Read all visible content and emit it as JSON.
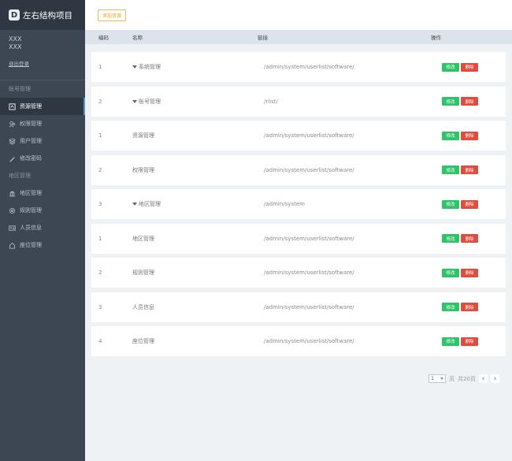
{
  "brand": {
    "logo_letter": "D",
    "title": "左右结构项目"
  },
  "user": {
    "name1": "XXX",
    "name2": "XXX",
    "logout": "退出登录"
  },
  "nav_groups": [
    {
      "title": "账号管理",
      "items": [
        {
          "label": "资源管理",
          "icon": "resource-icon",
          "active": true
        },
        {
          "label": "权限管理",
          "icon": "users-icon",
          "active": false
        },
        {
          "label": "用户管理",
          "icon": "layers-icon",
          "active": false
        },
        {
          "label": "修改密码",
          "icon": "pen-icon",
          "active": false
        }
      ]
    },
    {
      "title": "地区管理",
      "items": [
        {
          "label": "地区管理",
          "icon": "bank-icon",
          "active": false
        },
        {
          "label": "规则管理",
          "icon": "gear-icon",
          "active": false
        },
        {
          "label": "人员信息",
          "icon": "id-card-icon",
          "active": false
        },
        {
          "label": "座位管理",
          "icon": "home-icon",
          "active": false
        }
      ]
    }
  ],
  "toolbar": {
    "add_label": "添加资源"
  },
  "table": {
    "headers": {
      "id": "编码",
      "name": "名称",
      "link": "链接",
      "op": "操作"
    },
    "edit_label": "修改",
    "delete_label": "删除",
    "rows": [
      {
        "id": "1",
        "name": "系统管理",
        "link": "/admin/system/userlist/software/",
        "expand": true
      },
      {
        "id": "2",
        "name": "账号管理",
        "link": "/rlist/",
        "expand": true
      },
      {
        "id": "1",
        "name": "资源管理",
        "link": "/admin/system/userlist/software/",
        "expand": false
      },
      {
        "id": "2",
        "name": "权限管理",
        "link": "/admin/system/userlist/software/",
        "expand": false
      },
      {
        "id": "3",
        "name": "地区管理",
        "link": "/admin/system",
        "expand": true
      },
      {
        "id": "1",
        "name": "地区管理",
        "link": "/admin/system/userlist/software/",
        "expand": false
      },
      {
        "id": "2",
        "name": "规则管理",
        "link": "/admin/system/userlist/software/",
        "expand": false
      },
      {
        "id": "3",
        "name": "人员信息",
        "link": "/admin/system/userlist/software/",
        "expand": false
      },
      {
        "id": "4",
        "name": "座位管理",
        "link": "/admin/system/userlist/software/",
        "expand": false
      }
    ]
  },
  "pager": {
    "current": "1",
    "page_suffix": "页",
    "total": "共20页",
    "prev": "‹",
    "next": "›"
  },
  "colors": {
    "sidebar": "#3d4653",
    "sidebar_dark": "#2f3742",
    "edit": "#2fc36a",
    "delete": "#e24c3d",
    "add_border": "#e5b86b"
  }
}
